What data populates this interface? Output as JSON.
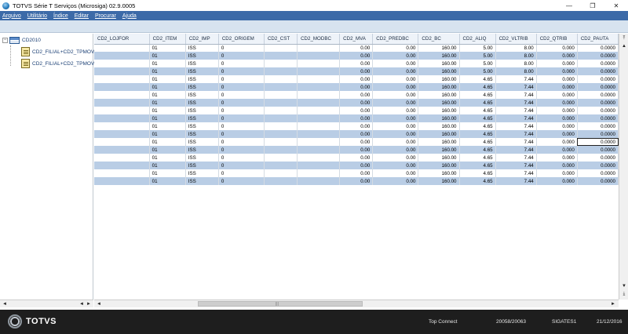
{
  "window": {
    "title": "TOTVS Série T Serviços (Microsiga) 02.9.0005",
    "controls": {
      "minimize": "—",
      "maximize": "❐",
      "close": "✕"
    }
  },
  "menu": [
    "Arquivo",
    "Utilitário",
    "Índice",
    "Editar",
    "Procurar",
    "Ajuda"
  ],
  "tree": {
    "root": "CD2010",
    "children": [
      "CD2_FILIAL+CD2_TPMOV+",
      "CD2_FILIAL+CD2_TPMOV+"
    ]
  },
  "grid": {
    "columns": [
      "CD2_LOJFOR",
      "CD2_ITEM",
      "CD2_IMP",
      "CD2_ORIGEM",
      "CD2_CST",
      "CD2_MODBC",
      "CD2_MVA",
      "CD2_PREDBC",
      "CD2_BC",
      "CD2_ALIQ",
      "CD2_VLTRIB",
      "CD2_QTRIB",
      "CD2_PAUTA"
    ],
    "rows": [
      [
        "",
        "01",
        "ISS",
        "0",
        "",
        "",
        "0.00",
        "0.00",
        "160.00",
        "5.00",
        "8.00",
        "0.000",
        "0.0000"
      ],
      [
        "",
        "01",
        "ISS",
        "0",
        "",
        "",
        "0.00",
        "0.00",
        "160.00",
        "5.00",
        "8.00",
        "0.000",
        "0.0000"
      ],
      [
        "",
        "01",
        "ISS",
        "0",
        "",
        "",
        "0.00",
        "0.00",
        "160.00",
        "5.00",
        "8.00",
        "0.000",
        "0.0000"
      ],
      [
        "",
        "01",
        "ISS",
        "0",
        "",
        "",
        "0.00",
        "0.00",
        "160.00",
        "5.00",
        "8.00",
        "0.000",
        "0.0000"
      ],
      [
        "",
        "01",
        "ISS",
        "0",
        "",
        "",
        "0.00",
        "0.00",
        "160.00",
        "4.65",
        "7.44",
        "0.000",
        "0.0000"
      ],
      [
        "",
        "01",
        "ISS",
        "0",
        "",
        "",
        "0.00",
        "0.00",
        "160.00",
        "4.65",
        "7.44",
        "0.000",
        "0.0000"
      ],
      [
        "",
        "01",
        "ISS",
        "0",
        "",
        "",
        "0.00",
        "0.00",
        "160.00",
        "4.65",
        "7.44",
        "0.000",
        "0.0000"
      ],
      [
        "",
        "01",
        "ISS",
        "0",
        "",
        "",
        "0.00",
        "0.00",
        "160.00",
        "4.65",
        "7.44",
        "0.000",
        "0.0000"
      ],
      [
        "",
        "01",
        "ISS",
        "0",
        "",
        "",
        "0.00",
        "0.00",
        "160.00",
        "4.65",
        "7.44",
        "0.000",
        "0.0000"
      ],
      [
        "",
        "01",
        "ISS",
        "0",
        "",
        "",
        "0.00",
        "0.00",
        "160.00",
        "4.65",
        "7.44",
        "0.000",
        "0.0000"
      ],
      [
        "",
        "01",
        "ISS",
        "0",
        "",
        "",
        "0.00",
        "0.00",
        "160.00",
        "4.65",
        "7.44",
        "0.000",
        "0.0000"
      ],
      [
        "",
        "01",
        "ISS",
        "0",
        "",
        "",
        "0.00",
        "0.00",
        "160.00",
        "4.65",
        "7.44",
        "0.000",
        "0.0000"
      ],
      [
        "",
        "01",
        "ISS",
        "0",
        "",
        "",
        "0.00",
        "0.00",
        "160.00",
        "4.65",
        "7.44",
        "0.000",
        "0.0000"
      ],
      [
        "",
        "01",
        "ISS",
        "0",
        "",
        "",
        "0.00",
        "0.00",
        "160.00",
        "4.65",
        "7.44",
        "0.000",
        "0.0000"
      ],
      [
        "",
        "01",
        "ISS",
        "0",
        "",
        "",
        "0.00",
        "0.00",
        "160.00",
        "4.65",
        "7.44",
        "0.000",
        "0.0000"
      ],
      [
        "",
        "01",
        "ISS",
        "0",
        "",
        "",
        "0.00",
        "0.00",
        "160.00",
        "4.65",
        "7.44",
        "0.000",
        "0.0000"
      ],
      [
        "",
        "01",
        "ISS",
        "0",
        "",
        "",
        "0.00",
        "0.00",
        "160.00",
        "4.65",
        "7.44",
        "0.000",
        "0.0000"
      ],
      [
        "",
        "01",
        "ISS",
        "0",
        "",
        "",
        "0.00",
        "0.00",
        "160.00",
        "4.65",
        "7.44",
        "0.000",
        "0.0000"
      ]
    ],
    "selected_cell": {
      "row": 12,
      "col": 12
    }
  },
  "scroll_glyphs": {
    "top": "⤒",
    "up": "▲",
    "down": "▼",
    "bottom": "⤓",
    "left": "◄",
    "right": "►",
    "grip": "|||"
  },
  "status": {
    "brand": "TOTVS",
    "connection": "Top Connect",
    "session": "20058/20063",
    "environment": "SIGATES1",
    "date": "21/12/2016"
  },
  "colors": {
    "menubar": "#3c6aa8",
    "alt_row": "#b9cde5",
    "statusbar": "#1e1e1e"
  }
}
